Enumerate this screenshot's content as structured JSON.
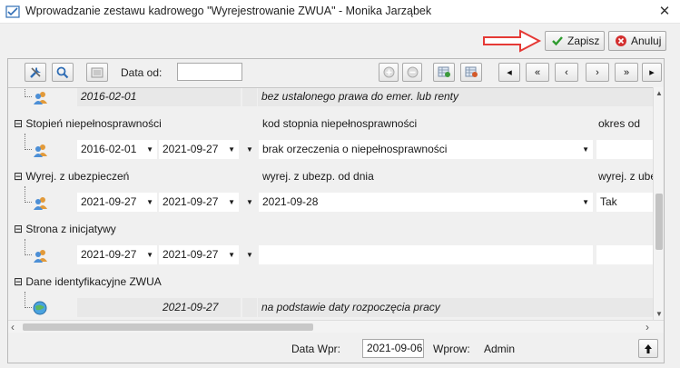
{
  "window": {
    "title": "Wprowadzanie zestawu kadrowego \"Wyrejestrowanie ZWUA\" - Monika Jarząbek",
    "close_glyph": "✕"
  },
  "actions": {
    "save_label": "Zapisz",
    "cancel_label": "Anuluj"
  },
  "toolbar": {
    "date_from_label": "Data od:",
    "date_from_value": "",
    "nav": [
      "◂",
      "«",
      "‹",
      "›",
      "»",
      "▸"
    ]
  },
  "grid": {
    "rows": [
      {
        "kind": "data",
        "style": "grey",
        "date_from": "2016-02-01",
        "date_to": "",
        "value": "bez ustalonego prawa do emer. lub renty",
        "extra": ""
      },
      {
        "kind": "header",
        "label": "⊟ Stopień niepełnosprawności",
        "col_main": "kod stopnia niepełnosprawności",
        "col_extra": "okres od"
      },
      {
        "kind": "data",
        "style": "normal",
        "date_from": "2016-02-01",
        "date_to": "2021-09-27",
        "value": "brak orzeczenia o niepełnosprawności",
        "extra": ""
      },
      {
        "kind": "header",
        "label": "⊟ Wyrej. z ubezpieczeń",
        "col_main": "wyrej. z ubezp. od dnia",
        "col_extra": "wyrej. z ubez"
      },
      {
        "kind": "data",
        "style": "normal",
        "date_from": "2021-09-27",
        "date_to": "2021-09-27",
        "value": "2021-09-28",
        "extra": "Tak"
      },
      {
        "kind": "header",
        "label": "⊟ Strona z inicjatywy",
        "col_main": "",
        "col_extra": ""
      },
      {
        "kind": "data",
        "style": "normal",
        "date_from": "2021-09-27",
        "date_to": "2021-09-27",
        "value": "",
        "extra": ""
      },
      {
        "kind": "header",
        "label": "⊟ Dane identyfikacyjne ZWUA",
        "col_main": "",
        "col_extra": ""
      },
      {
        "kind": "data",
        "style": "grey",
        "date_from": "",
        "date_to": "2021-09-27",
        "value": "na podstawie daty rozpoczęcia pracy",
        "extra": ""
      }
    ]
  },
  "footer": {
    "date_entered_label": "Data Wpr:",
    "date_entered_value": "2021-09-06",
    "entered_by_label": "Wprow:",
    "entered_by_value": "Admin"
  },
  "colors": {
    "accent_red": "#e53935",
    "save_green": "#2e9b2e",
    "cancel_red": "#d32f2f"
  }
}
